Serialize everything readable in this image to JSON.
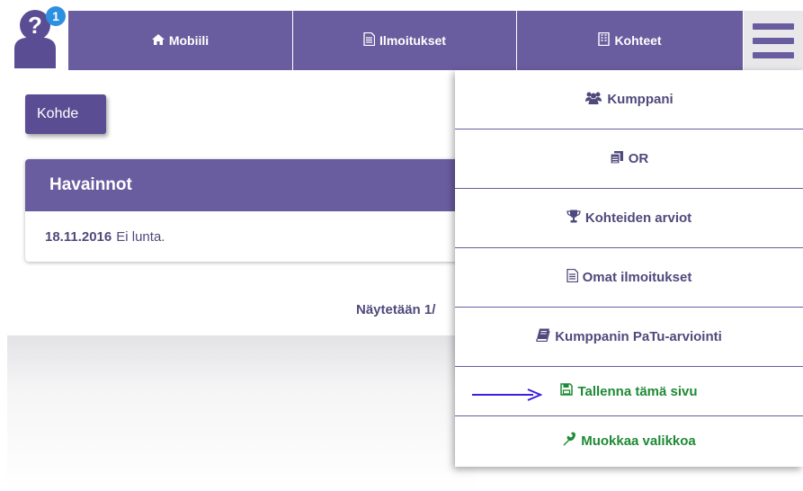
{
  "header": {
    "notification_count": "1",
    "nav": [
      {
        "label": "Mobiili",
        "icon": "home-icon"
      },
      {
        "label": "Ilmoitukset",
        "icon": "document-icon"
      },
      {
        "label": "Kohteet",
        "icon": "building-icon"
      }
    ],
    "menu_icon": "hamburger-menu-icon"
  },
  "main": {
    "kohde_button": "Kohde",
    "panel": {
      "title": "Havainnot",
      "date": "18.11.2016",
      "text": "Ei lunta."
    },
    "showing_text": "Näytetään 1/"
  },
  "dropdown": {
    "items": [
      {
        "label": "Kumppani",
        "icon": "users-icon"
      },
      {
        "label": "OR",
        "icon": "copy-icon"
      },
      {
        "label": "Kohteiden arviot",
        "icon": "trophy-icon"
      },
      {
        "label": "Omat ilmoitukset",
        "icon": "document-icon"
      },
      {
        "label": "Kumppanin PaTu-arviointi",
        "icon": "book-icon"
      },
      {
        "label": "Tallenna tämä sivu",
        "icon": "save-icon"
      },
      {
        "label": "Muokkaa valikkoa",
        "icon": "wrench-icon"
      }
    ]
  },
  "colors": {
    "nav_purple": "#6a5d9f",
    "text_purple": "#4f4a7c",
    "green": "#1e8a35",
    "arrow_blue": "#3b1fe0"
  }
}
